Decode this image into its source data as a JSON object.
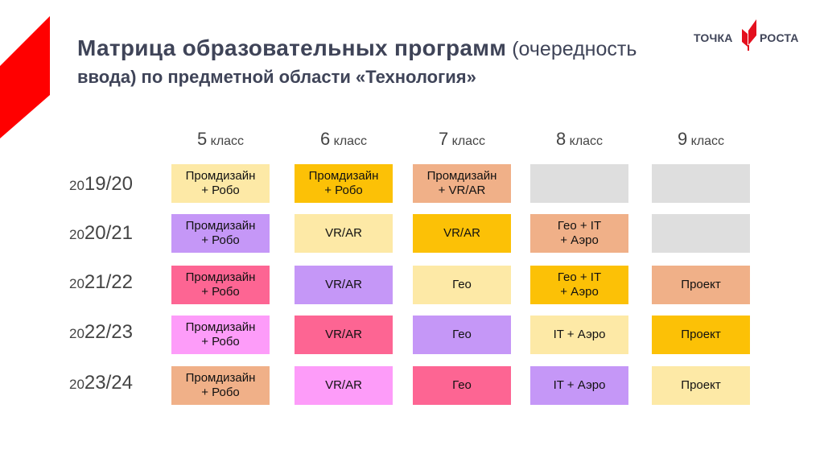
{
  "title": {
    "bold_part": "Матрица образовательных программ",
    "normal_part": " (очередность",
    "line2": "ввода) по предметной области «Технология»"
  },
  "logo": {
    "left_word": "ТОЧКА",
    "right_word": "РОСТА"
  },
  "colors": {
    "accent_red": "#ff0000",
    "title": "#3f4458",
    "light_yellow": "#fde9a6",
    "amber": "#fcc106",
    "purple": "#c597f7",
    "pink": "#fd6593",
    "light_pink": "#fd9cf9",
    "peach": "#f0b088",
    "gray": "#dedede"
  },
  "matrix": {
    "columns": [
      {
        "num": "5",
        "label": " класс"
      },
      {
        "num": "6",
        "label": " класс"
      },
      {
        "num": "7",
        "label": " класс"
      },
      {
        "num": "8",
        "label": " класс"
      },
      {
        "num": "9",
        "label": " класс"
      }
    ],
    "rows": [
      {
        "year_prefix": "20",
        "year": "19/20",
        "cells": [
          {
            "l1": "Промдизайн",
            "l2": "+ Робо",
            "color": "#fde9a6"
          },
          {
            "l1": "Промдизайн",
            "l2": "+ Робо",
            "color": "#fcc106"
          },
          {
            "l1": "Промдизайн",
            "l2": "+ VR/AR",
            "color": "#f0b088"
          },
          {
            "l1": "",
            "l2": "",
            "color": "#dedede"
          },
          {
            "l1": "",
            "l2": "",
            "color": "#dedede"
          }
        ]
      },
      {
        "year_prefix": "20",
        "year": "20/21",
        "cells": [
          {
            "l1": "Промдизайн",
            "l2": "+ Робо",
            "color": "#c597f7"
          },
          {
            "l1": "VR/AR",
            "l2": "",
            "color": "#fde9a6"
          },
          {
            "l1": "VR/AR",
            "l2": "",
            "color": "#fcc106"
          },
          {
            "l1": "Гео + IT",
            "l2": "+ Аэро",
            "color": "#f0b088"
          },
          {
            "l1": "",
            "l2": "",
            "color": "#dedede"
          }
        ]
      },
      {
        "year_prefix": "20",
        "year": "21/22",
        "cells": [
          {
            "l1": "Промдизайн",
            "l2": "+ Робо",
            "color": "#fd6593"
          },
          {
            "l1": "VR/AR",
            "l2": "",
            "color": "#c597f7"
          },
          {
            "l1": "Гео",
            "l2": "",
            "color": "#fde9a6"
          },
          {
            "l1": "Гео + IT",
            "l2": "+ Аэро",
            "color": "#fcc106"
          },
          {
            "l1": "Проект",
            "l2": "",
            "color": "#f0b088"
          }
        ]
      },
      {
        "year_prefix": "20",
        "year": "22/23",
        "cells": [
          {
            "l1": "Промдизайн",
            "l2": "+ Робо",
            "color": "#fd9cf9"
          },
          {
            "l1": "VR/AR",
            "l2": "",
            "color": "#fd6593"
          },
          {
            "l1": "Гео",
            "l2": "",
            "color": "#c597f7"
          },
          {
            "l1": "IT + Аэро",
            "l2": "",
            "color": "#fde9a6"
          },
          {
            "l1": "Проект",
            "l2": "",
            "color": "#fcc106"
          }
        ]
      },
      {
        "year_prefix": "20",
        "year": "23/24",
        "cells": [
          {
            "l1": "Промдизайн",
            "l2": "+ Робо",
            "color": "#f0b088"
          },
          {
            "l1": "VR/AR",
            "l2": "",
            "color": "#fd9cf9"
          },
          {
            "l1": "Гео",
            "l2": "",
            "color": "#fd6593"
          },
          {
            "l1": "IT + Аэро",
            "l2": "",
            "color": "#c597f7"
          },
          {
            "l1": "Проект",
            "l2": "",
            "color": "#fde9a6"
          }
        ]
      }
    ]
  }
}
